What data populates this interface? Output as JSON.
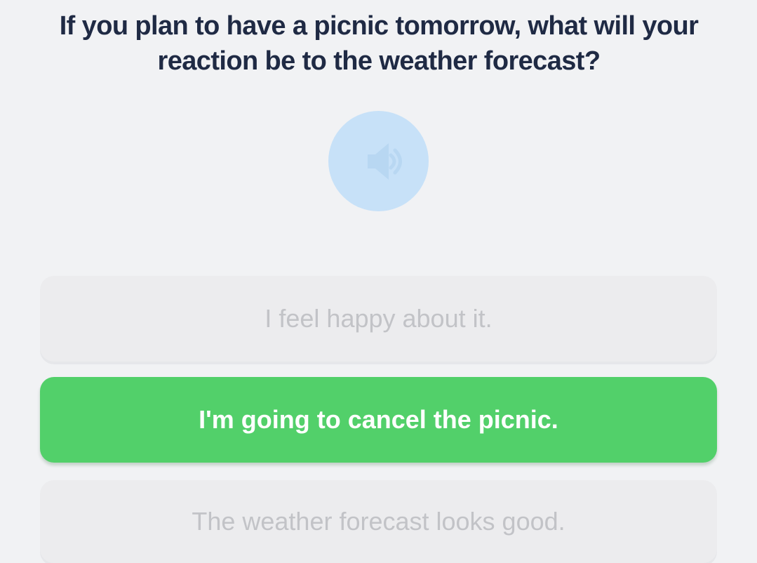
{
  "question": {
    "text": "If you plan to have a picnic tomorrow, what will your reaction be to the weather forecast?"
  },
  "audio": {
    "icon": "speaker-icon",
    "color": "#c7e1f8"
  },
  "options": [
    {
      "label": "I feel happy about it.",
      "state": "disabled"
    },
    {
      "label": "I'm going to cancel the picnic.",
      "state": "selected",
      "color": "#52d06a"
    },
    {
      "label": "The weather forecast looks good.",
      "state": "disabled"
    }
  ]
}
